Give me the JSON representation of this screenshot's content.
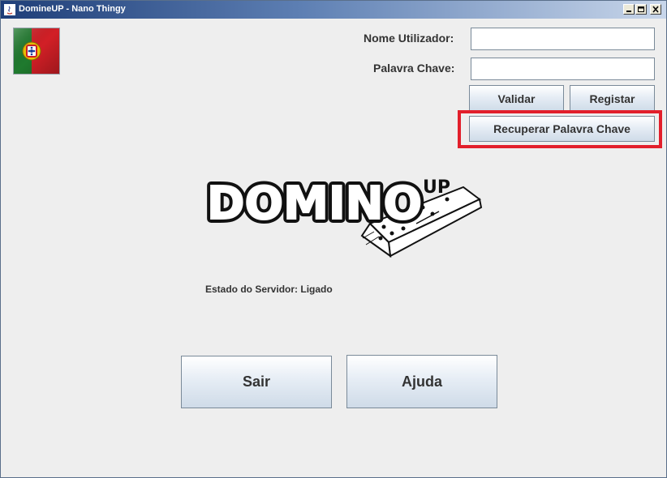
{
  "window": {
    "title": "DomineUP - Nano Thingy",
    "controls": [
      "minimize-icon",
      "maximize-icon",
      "close-icon"
    ]
  },
  "login": {
    "username_label": "Nome Utilizador:",
    "username_value": "",
    "password_label": "Palavra Chave:",
    "password_value": "",
    "validate_label": "Validar",
    "register_label": "Registar",
    "recover_label": "Recuperar Palavra Chave"
  },
  "logo": {
    "text_main": "DOMINO",
    "text_sup": "UP"
  },
  "status": {
    "label": "Estado do Servidor:",
    "value": "Ligado"
  },
  "actions": {
    "exit_label": "Sair",
    "help_label": "Ajuda"
  },
  "language": {
    "flag_icon": "portugal-flag-icon"
  },
  "colors": {
    "highlight": "#e21f2b",
    "flag_green": "#1f7a2e",
    "flag_red": "#d21f26"
  }
}
